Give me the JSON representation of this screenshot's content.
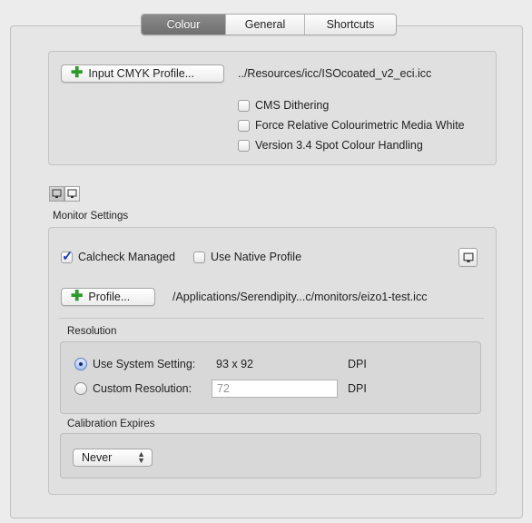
{
  "tabs": [
    "Colour",
    "General",
    "Shortcuts"
  ],
  "input_profile": {
    "button_label": "Input CMYK Profile...",
    "path": "../Resources/icc/ISOcoated_v2_eci.icc"
  },
  "options": [
    {
      "label": "CMS Dithering",
      "checked": false
    },
    {
      "label": "Force Relative Colourimetric Media White",
      "checked": false
    },
    {
      "label": "Version 3.4 Spot Colour Handling",
      "checked": false
    }
  ],
  "monitor": {
    "section_label": "Monitor Settings",
    "calcheck_label": "Calcheck Managed",
    "calcheck_checked": true,
    "native_label": "Use Native Profile",
    "native_checked": false,
    "profile_button_label": "Profile...",
    "profile_path": "/Applications/Serendipity...c/monitors/eizo1-test.icc"
  },
  "resolution": {
    "label": "Resolution",
    "system_label": "Use System Setting:",
    "system_value": "93 x 92",
    "system_unit": "DPI",
    "custom_label": "Custom Resolution:",
    "custom_placeholder": "72",
    "custom_unit": "DPI",
    "selected": "system"
  },
  "calibration": {
    "label": "Calibration Expires",
    "value": "Never"
  },
  "icons": {
    "add": "plus-icon",
    "monitor": "monitor-icon"
  }
}
